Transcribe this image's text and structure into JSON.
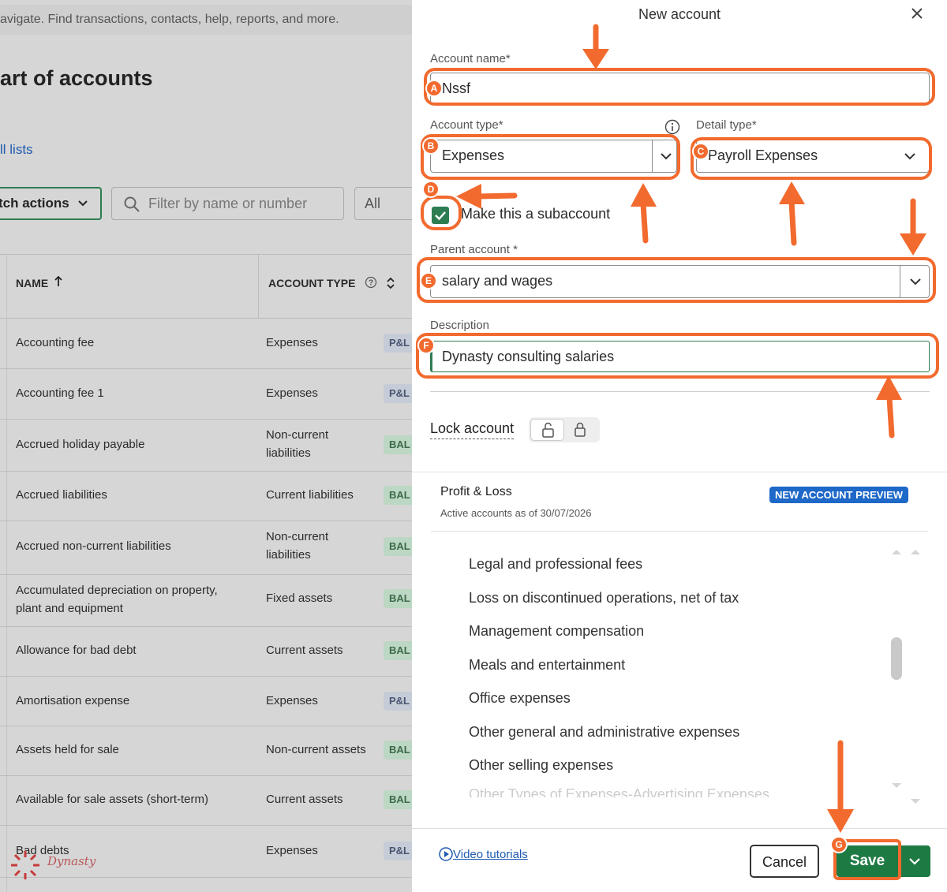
{
  "background": {
    "search_text": "avigate. Find transactions, contacts, help, reports, and more.",
    "page_title": "art of accounts",
    "all_lists_link": "ll lists",
    "batch_actions": "tch actions",
    "filter_placeholder": "Filter by name or number",
    "filter_dropdown": "All",
    "col_name": "NAME",
    "col_type": "ACCOUNT TYPE",
    "rows": [
      {
        "name": "Accounting fee",
        "type": "Expenses",
        "badge": "P&L"
      },
      {
        "name": "Accounting fee 1",
        "type": "Expenses",
        "badge": "P&L"
      },
      {
        "name": "Accrued holiday payable",
        "type": "Non-current liabilities",
        "badge": "BAL"
      },
      {
        "name": "Accrued liabilities",
        "type": "Current liabilities",
        "badge": "BAL"
      },
      {
        "name": "Accrued non-current liabilities",
        "type": "Non-current liabilities",
        "badge": "BAL"
      },
      {
        "name": "Accumulated depreciation on property, plant and equipment",
        "type": "Fixed assets",
        "badge": "BAL"
      },
      {
        "name": "Allowance for bad debt",
        "type": "Current assets",
        "badge": "BAL"
      },
      {
        "name": "Amortisation expense",
        "type": "Expenses",
        "badge": "P&L"
      },
      {
        "name": "Assets held for sale",
        "type": "Non-current assets",
        "badge": "BAL"
      },
      {
        "name": "Available for sale assets (short-term)",
        "type": "Current assets",
        "badge": "BAL"
      },
      {
        "name": "Bad debts",
        "type": "Expenses",
        "badge": "P&L"
      }
    ],
    "logo_text": "Dynasty"
  },
  "panel": {
    "title": "New account",
    "account_name_label": "Account name*",
    "account_name_value": "Nssf",
    "account_type_label": "Account type*",
    "account_type_value": "Expenses",
    "detail_type_label": "Detail type*",
    "detail_type_value": "Payroll Expenses",
    "subaccount_label": "Make this a subaccount",
    "subaccount_checked": true,
    "parent_label": "Parent account *",
    "parent_value": "salary and wages",
    "description_label": "Description",
    "description_value": "Dynasty consulting salaries",
    "lock_label": "Lock account"
  },
  "preview": {
    "heading": "Profit & Loss",
    "subheading": "Active accounts as of 30/07/2026",
    "badge": "NEW ACCOUNT PREVIEW",
    "items": [
      "Legal and professional fees",
      "Loss on discontinued operations, net of tax",
      "Management compensation",
      "Meals and entertainment",
      "Office expenses",
      "Other general and administrative expenses",
      "Other selling expenses"
    ],
    "partial_item": "Other Types of Expenses-Advertising Expenses"
  },
  "footer": {
    "video_link": "Video tutorials",
    "cancel": "Cancel",
    "save": "Save"
  },
  "annotations": {
    "markers": [
      "A",
      "B",
      "C",
      "D",
      "E",
      "F",
      "G"
    ],
    "color": "#f26a2e"
  },
  "colors": {
    "accent_green": "#2e7d52",
    "save_green": "#1e7a43",
    "link_blue": "#1f5bb0",
    "badge_blue": "#1e68c8"
  }
}
